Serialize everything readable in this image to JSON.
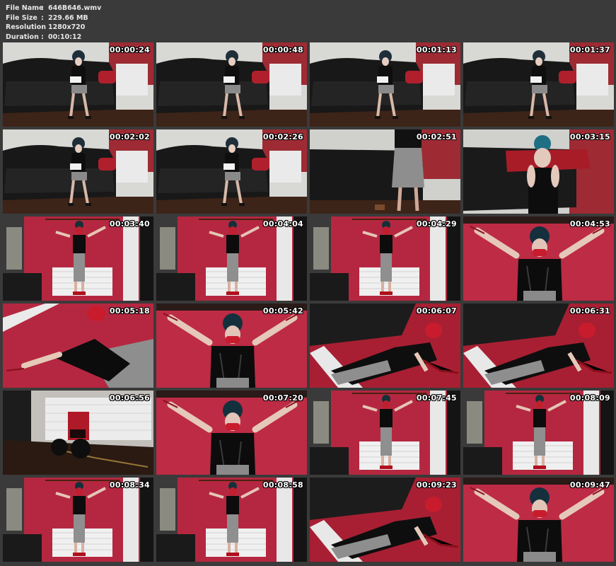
{
  "file_info": {
    "name_label": "File Name",
    "name_value": "646B646.wmv",
    "size_label": "File Size",
    "size_value": "229.66 MB",
    "res_label": "Resolution",
    "res_value": "1280x720",
    "dur_label": "Duration",
    "dur_value": "00:10:12",
    "sep": ":"
  },
  "thumbnails": [
    {
      "time": "00:00:24",
      "scene": "sofa"
    },
    {
      "time": "00:00:48",
      "scene": "sofa"
    },
    {
      "time": "00:01:13",
      "scene": "sofa"
    },
    {
      "time": "00:01:37",
      "scene": "sofa"
    },
    {
      "time": "00:02:02",
      "scene": "sofa"
    },
    {
      "time": "00:02:26",
      "scene": "sofa"
    },
    {
      "time": "00:02:51",
      "scene": "sofa-stand"
    },
    {
      "time": "00:03:15",
      "scene": "sofa-close"
    },
    {
      "time": "00:03:40",
      "scene": "wall-wide"
    },
    {
      "time": "00:04:04",
      "scene": "wall-wide"
    },
    {
      "time": "00:04:29",
      "scene": "wall-wide"
    },
    {
      "time": "00:04:53",
      "scene": "wall-close"
    },
    {
      "time": "00:05:18",
      "scene": "tilted"
    },
    {
      "time": "00:05:42",
      "scene": "wall-close"
    },
    {
      "time": "00:06:07",
      "scene": "floor"
    },
    {
      "time": "00:06:31",
      "scene": "floor"
    },
    {
      "time": "00:06:56",
      "scene": "feet"
    },
    {
      "time": "00:07:20",
      "scene": "wall-close"
    },
    {
      "time": "00:07:45",
      "scene": "wall-wide"
    },
    {
      "time": "00:08:09",
      "scene": "wall-wide"
    },
    {
      "time": "00:08:34",
      "scene": "wall-wide"
    },
    {
      "time": "00:08:58",
      "scene": "wall-wide"
    },
    {
      "time": "00:09:23",
      "scene": "floor"
    },
    {
      "time": "00:09:47",
      "scene": "wall-close"
    }
  ]
}
